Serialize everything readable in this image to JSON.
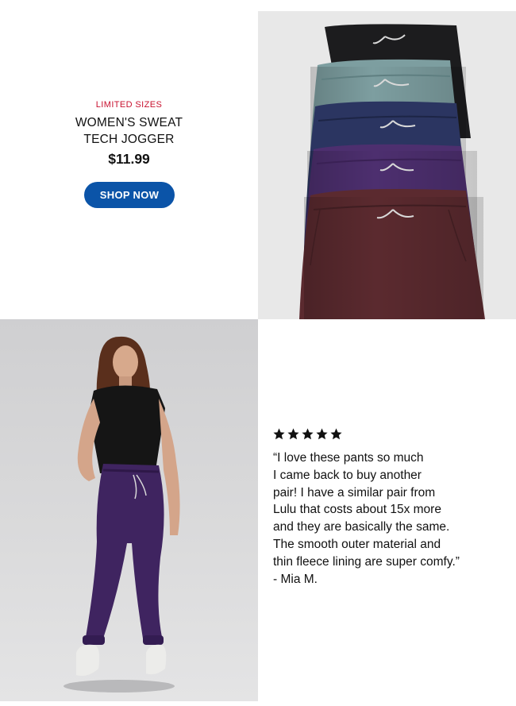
{
  "product": {
    "badge": "LIMITED SIZES",
    "name_line1": "WOMEN'S SWEAT",
    "name_line2": "TECH JOGGER",
    "price": "$11.99",
    "cta": "SHOP NOW"
  },
  "jogger_colors": [
    "#1c1c1e",
    "#7d9ea0",
    "#2b3561",
    "#4d2f6f",
    "#5b2a2f"
  ],
  "review": {
    "rating": 5,
    "text": "“I love these pants so much\nI came back to buy another\npair! I have a similar pair from\nLulu that costs about 15x more\nand they are basically the same.\nThe smooth outer material and\nthin fleece lining are super comfy.”\n- Mia M."
  }
}
